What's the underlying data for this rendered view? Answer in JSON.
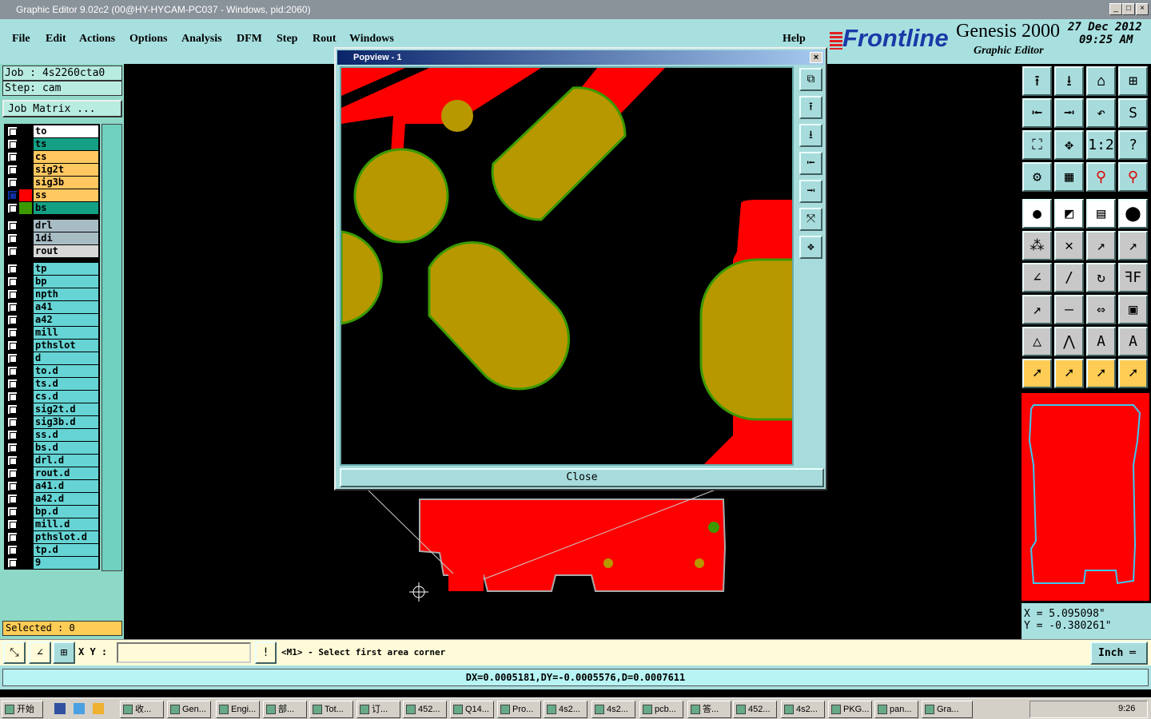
{
  "window": {
    "title": "Graphic Editor 9.02c2 (00@HY-HYCAM-PC037 - Windows, pid:2060)"
  },
  "menu": [
    "File",
    "Edit",
    "Actions",
    "Options",
    "Analysis",
    "DFM",
    "Step",
    "Rout",
    "Windows",
    "Help"
  ],
  "brand": {
    "logo": "Frontline",
    "product": "Genesis 2000",
    "subtitle": "Graphic Editor",
    "date": "27 Dec 2012",
    "time": "09:25 AM"
  },
  "job": {
    "job_label": "Job  : 4s2260cta0",
    "step_label": "Step: cam",
    "matrix_button": "Job Matrix ..."
  },
  "layers": [
    {
      "name": "to",
      "color": "#ffffff"
    },
    {
      "name": "ts",
      "color": "#14a084"
    },
    {
      "name": "cs",
      "color": "#ffc860"
    },
    {
      "name": "sig2t",
      "color": "#ffc860"
    },
    {
      "name": "sig3b",
      "color": "#ffc860"
    },
    {
      "name": "ss",
      "color": "#ffc860",
      "display": "#ff0000",
      "active": true
    },
    {
      "name": "bs",
      "color": "#14a084",
      "display": "#3c9a00"
    },
    {
      "name": "drl",
      "color": "#a8bcc4"
    },
    {
      "name": "1di",
      "color": "#a8bcc4"
    },
    {
      "name": "rout",
      "color": "#d8d8d8"
    },
    {
      "name": "tp",
      "color": "#66d4d4"
    },
    {
      "name": "bp",
      "color": "#66d4d4"
    },
    {
      "name": "npth",
      "color": "#66d4d4"
    },
    {
      "name": "a41",
      "color": "#66d4d4"
    },
    {
      "name": "a42",
      "color": "#66d4d4"
    },
    {
      "name": "mill",
      "color": "#66d4d4"
    },
    {
      "name": "pthslot",
      "color": "#66d4d4"
    },
    {
      "name": "d",
      "color": "#66d4d4"
    },
    {
      "name": "to.d",
      "color": "#66d4d4"
    },
    {
      "name": "ts.d",
      "color": "#66d4d4"
    },
    {
      "name": "cs.d",
      "color": "#66d4d4"
    },
    {
      "name": "sig2t.d",
      "color": "#66d4d4"
    },
    {
      "name": "sig3b.d",
      "color": "#66d4d4"
    },
    {
      "name": "ss.d",
      "color": "#66d4d4"
    },
    {
      "name": "bs.d",
      "color": "#66d4d4"
    },
    {
      "name": "drl.d",
      "color": "#66d4d4"
    },
    {
      "name": "rout.d",
      "color": "#66d4d4"
    },
    {
      "name": "a41.d",
      "color": "#66d4d4"
    },
    {
      "name": "a42.d",
      "color": "#66d4d4"
    },
    {
      "name": "bp.d",
      "color": "#66d4d4"
    },
    {
      "name": "mill.d",
      "color": "#66d4d4"
    },
    {
      "name": "pthslot.d",
      "color": "#66d4d4"
    },
    {
      "name": "tp.d",
      "color": "#66d4d4"
    },
    {
      "name": "9",
      "color": "#66d4d4"
    }
  ],
  "selected": "Selected : 0",
  "popview": {
    "title": "Popview - 1",
    "close_label": "Close",
    "tools": [
      "⧉",
      "⭱",
      "⭳",
      "⭰",
      "⭲",
      "⤧",
      "✥"
    ]
  },
  "toolbar_icons": [
    "⭱",
    "⭳",
    "⌂",
    "⊞",
    "⭰",
    "⭲",
    "↶",
    "S",
    "⛶",
    "✥",
    "1:2",
    "?",
    "⚙",
    "▦",
    "⚲",
    "⚲",
    "●",
    "◩",
    "▤",
    "⬤",
    "⁂",
    "✕",
    "↗",
    "↗",
    "∠",
    "/",
    "↻",
    "ꟻF",
    "↗",
    "—",
    "⇔",
    "▣",
    "△",
    "⋀",
    "A",
    "A",
    "➚",
    "➚",
    "➚",
    "➚"
  ],
  "coords": {
    "x": "X = 5.095098\"",
    "y": "Y = -0.380261\""
  },
  "cmd": {
    "xy_label": "X Y :",
    "xy_value": "",
    "prompt": "<M1> - Select first area corner",
    "units": "Inch"
  },
  "status": {
    "text": "DX=0.0005181,DY=-0.0005576,D=0.0007611"
  },
  "taskbar": {
    "start": "开始",
    "tasks": [
      "收...",
      "Gen...",
      "Engi...",
      "部...",
      "Tot...",
      "订...",
      "452...",
      "Q14...",
      "Pro...",
      "4s2...",
      "4s2...",
      "pcb...",
      "答...",
      "452...",
      "4s2...",
      "PKG...",
      "pan...",
      "Gra..."
    ],
    "clock": "9:26"
  },
  "colors": {
    "copper": "#ff0000",
    "pad": "#b89800",
    "pad_outline": "#3c9a00",
    "panel": "#a8e0e0"
  }
}
